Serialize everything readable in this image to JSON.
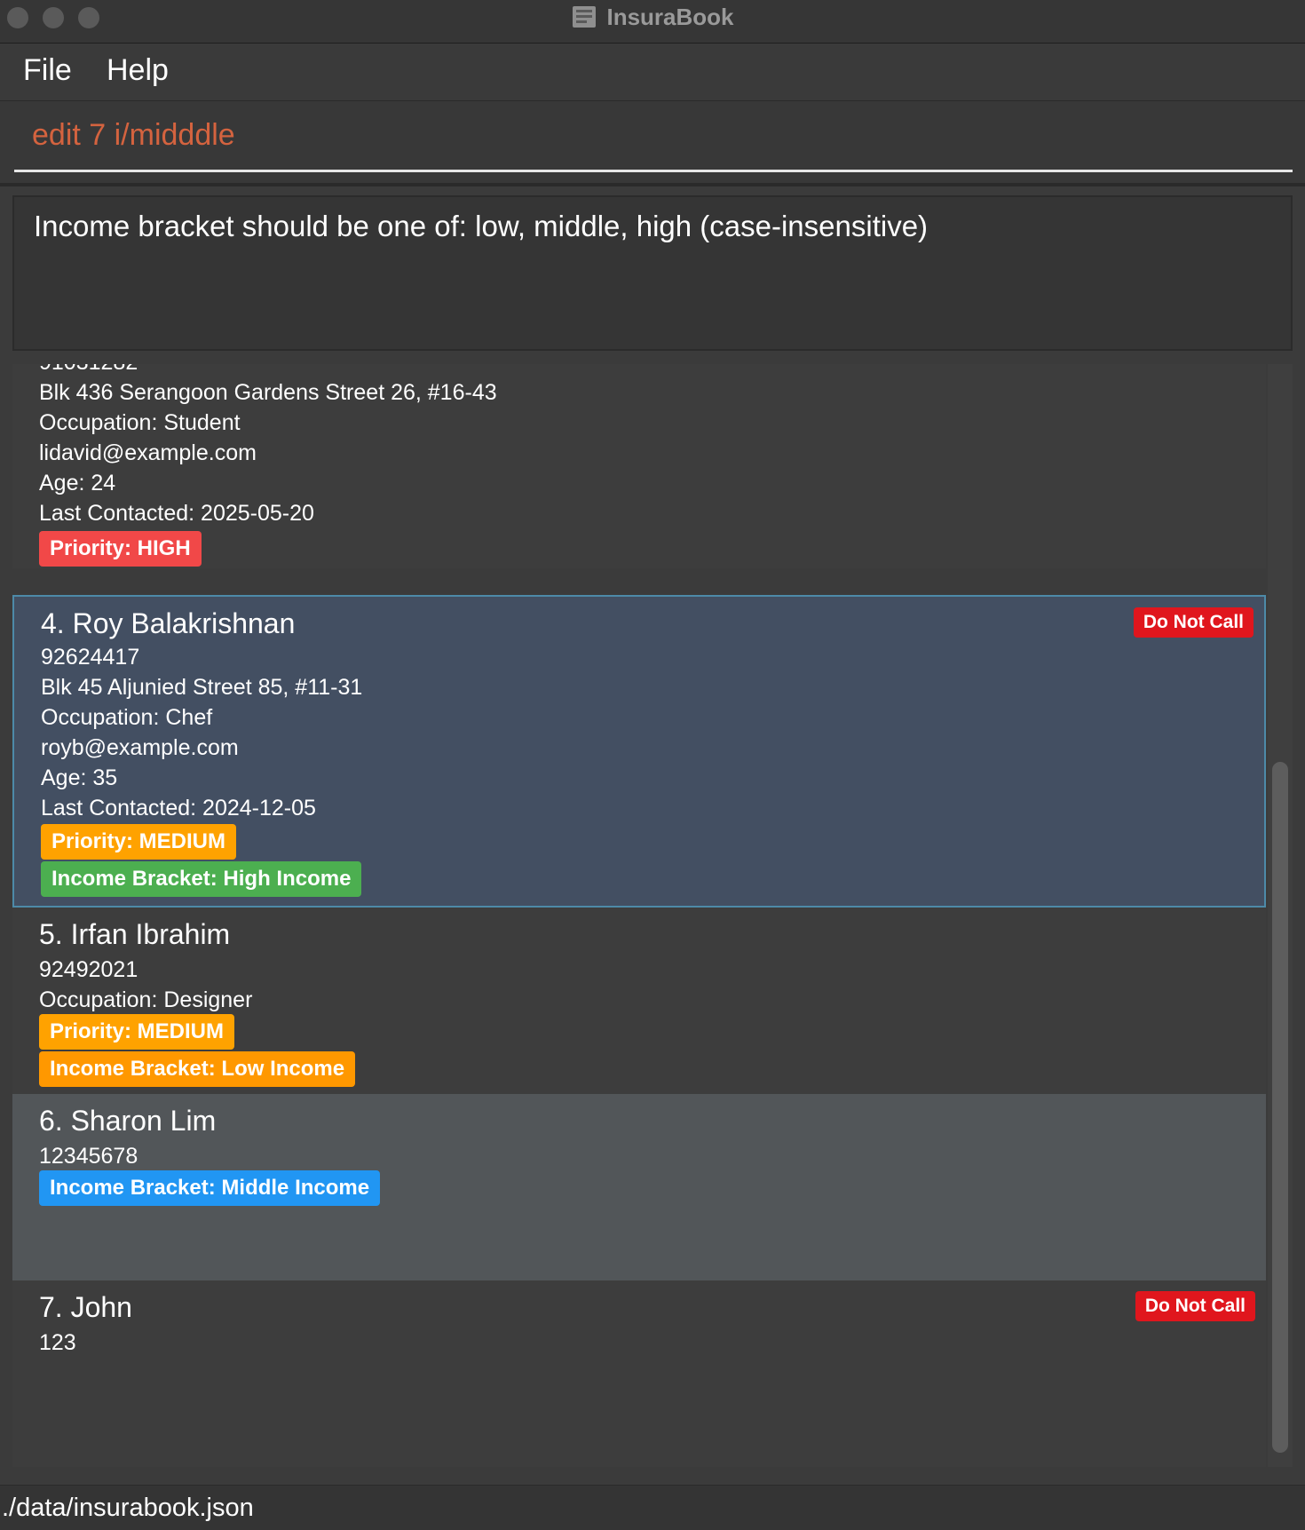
{
  "window": {
    "title": "InsuraBook"
  },
  "menu": {
    "file": "File",
    "help": "Help"
  },
  "command": {
    "value": "edit 7 i/midddle"
  },
  "result": {
    "message": "Income bracket should be one of: low, middle, high (case-insensitive)"
  },
  "colors": {
    "high": "#f14848",
    "medium": "#ffa200",
    "income_high": "#4caf50",
    "income_low": "#ff9800",
    "income_middle": "#2196f3",
    "do_not_call": "#e0161d",
    "command_text": "#d4633f"
  },
  "persons": [
    {
      "phone_partial": "91031282",
      "address": "Blk 436 Serangoon Gardens Street 26, #16-43",
      "occupation": "Occupation: Student",
      "email": "lidavid@example.com",
      "age": "Age: 24",
      "last_contacted": "Last Contacted: 2025-05-20",
      "priority": "Priority: HIGH"
    },
    {
      "name": "4. Roy Balakrishnan",
      "phone": "92624417",
      "address": "Blk 45 Aljunied Street 85, #11-31",
      "occupation": "Occupation: Chef",
      "email": "royb@example.com",
      "age": "Age: 35",
      "last_contacted": "Last Contacted: 2024-12-05",
      "priority": "Priority: MEDIUM",
      "income": "Income Bracket: High Income",
      "do_not_call": "Do Not Call"
    },
    {
      "name": "5. Irfan Ibrahim",
      "phone": "92492021",
      "occupation": "Occupation: Designer",
      "priority": "Priority: MEDIUM",
      "income": "Income Bracket: Low Income"
    },
    {
      "name": "6. Sharon Lim",
      "phone": "12345678",
      "income": "Income Bracket: Middle Income"
    },
    {
      "name": "7. John",
      "phone": "123",
      "do_not_call": "Do Not Call"
    }
  ],
  "status": {
    "file_path": "./data/insurabook.json"
  }
}
